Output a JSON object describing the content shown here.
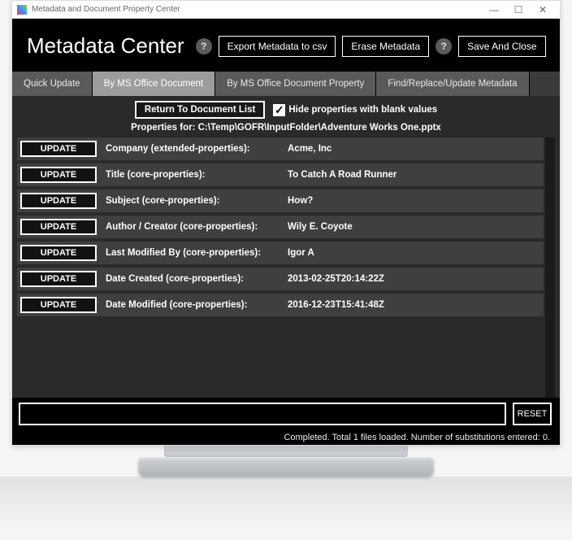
{
  "window": {
    "title": "Metadata and Document Property Center"
  },
  "header": {
    "app_title": "Metadata Center",
    "help1": "?",
    "export_btn": "Export Metadata to csv",
    "erase_btn": "Erase Metadata",
    "help2": "?",
    "save_btn": "Save And Close"
  },
  "tabs": [
    {
      "label": "Quick Update"
    },
    {
      "label": "By MS Office Document"
    },
    {
      "label": "By MS Office Document Property"
    },
    {
      "label": "Find/Replace/Update Metadata"
    }
  ],
  "toolbar": {
    "return_btn": "Return To Document List",
    "hide_blank_label": "Hide properties with blank values",
    "hide_blank_check": "✓",
    "path_prefix": "Properties for: ",
    "path": "C:\\Temp\\GOFR\\InputFolder\\Adventure Works One.pptx"
  },
  "rows": [
    {
      "btn": "UPDATE",
      "label": "Company (extended-properties):",
      "value": "Acme, Inc"
    },
    {
      "btn": "UPDATE",
      "label": "Title (core-properties):",
      "value": "To Catch A Road Runner"
    },
    {
      "btn": "UPDATE",
      "label": "Subject (core-properties):",
      "value": "How?"
    },
    {
      "btn": "UPDATE",
      "label": "Author / Creator (core-properties):",
      "value": "Wily E. Coyote"
    },
    {
      "btn": "UPDATE",
      "label": "Last Modified By (core-properties):",
      "value": "Igor A"
    },
    {
      "btn": "UPDATE",
      "label": "Date Created (core-properties):",
      "value": "2013-02-25T20:14:22Z"
    },
    {
      "btn": "UPDATE",
      "label": "Date Modified (core-properties):",
      "value": "2016-12-23T15:41:48Z"
    }
  ],
  "footer": {
    "reset_btn": "RESET",
    "status": "Completed. Total 1 files loaded. Number of substitutions entered: 0."
  }
}
